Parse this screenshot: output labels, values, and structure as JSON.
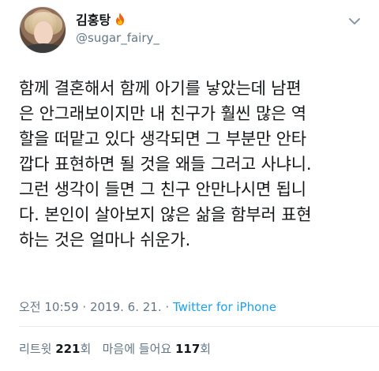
{
  "user": {
    "display_name": "김홍탕",
    "handle": "@sugar_fairy_",
    "name_emoji": "fire-icon"
  },
  "tweet": {
    "lines": [
      "함께 결혼해서 함께 아기를 낳았는데 남편",
      "은 안그래보이지만 내 친구가 훨씬 많은 역",
      "할을 떠맡고 있다 생각되면 그 부분만 안타",
      "깝다 표현하면 될 것을 왜들 그러고 사냐니.",
      "그런 생각이 들면 그 친구 안만나시면 됩니",
      "다. 본인이 살아보지 않은 삶을 함부러 표현",
      "하는 것은 얼마나 쉬운가."
    ],
    "time": "오전 10:59",
    "date": "2019. 6. 21.",
    "separator": "·",
    "source": "Twitter for iPhone"
  },
  "stats": {
    "retweet_label": "리트윗",
    "retweet_count": "221",
    "retweet_unit": "회",
    "like_label": "마음에 들어요",
    "like_count": "117",
    "like_unit": "회"
  },
  "colors": {
    "text": "#14171a",
    "muted": "#657786",
    "link": "#1da1f2",
    "divider": "#e6ecf0"
  }
}
